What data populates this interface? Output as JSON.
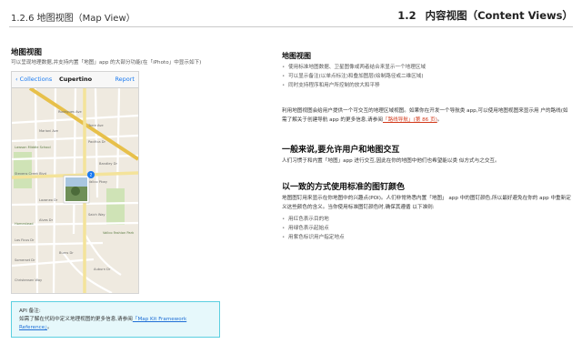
{
  "header": {
    "left": "1.2.6   地图视图（Map View）",
    "right_num": "1.2",
    "right_title": "内容视图（Content Views）"
  },
  "left": {
    "title": "地图视图",
    "subtitle": "可以呈现地理数据,并支持内置「地图」app 的大部分功能(在「iPhoto」中显示如下)"
  },
  "phone": {
    "back_label": "Collections",
    "title": "Cupertino",
    "action_label": "Report",
    "pin_count": "2",
    "streets": [
      "Stevens Creek Blvd",
      "Rodrigues Ave",
      "Torre Ave",
      "Pacifica Dr",
      "Mariani Ave",
      "Bandley Dr",
      "De Anza Blvd",
      "Vallco Pkwy",
      "Lazaneo Dr",
      "Alves Dr",
      "Saich Way",
      "Kentwood Ave",
      "Miller Ave",
      "Portal Ave",
      "Los Ficus Dr",
      "Somerset Dr",
      "Christensen Way",
      "Burns Dr",
      "Calle Ave",
      "Tantau Ave",
      "Auburn Dr",
      "Fremont Park"
    ],
    "places": [
      "Lawson Middle School",
      "Vallco Fashion Park",
      "Homestead"
    ]
  },
  "note": {
    "label": "API 备注:",
    "text": "如需了解在代码中定义地理视图的更多信息,请参阅",
    "link": "「Map Kit Framework Reference」",
    "tail": "。"
  },
  "right": {
    "s1": {
      "title": "地图视图",
      "bullets": [
        "使用标准地图数据、卫星图像或两者结合来显示一个地理区域",
        "可以显示备注(以单点标注)和叠加图层(绘制路径或二维区域)",
        "同时支持程序和用户所控制的放大和平移"
      ],
      "para": "利用地图视图会给用户提供一个可交互的地理区域视图。如果你在开发一个导航类 app,可以使用地图视图来显示用 户的路线(如需了解关于创建导航 app 的更多信息,请参阅",
      "para_link": "「路线导航」(第 86 页)",
      "para_tail": "。"
    },
    "s2": {
      "title": "一般来说,要允许用户和地图交互",
      "para": "人们习惯于和内置「地图」app 进行交互,因此在你的地图中他们也希望能以类 似方式与之交互。"
    },
    "s3": {
      "title": "以一致的方式使用标准的图钉颜色",
      "para": "地图图钉用来显示在你地图中的兴趣点(POI)。人们非常熟悉内置「地图」 app 中的图钉颜色,所以最好避免在你的 app 中重新定义这些颜色的含义。当你使用标准图钉颜色时,确保其遵循 以下准则:",
      "bullets": [
        "用红色表示目的地",
        "用绿色表示起始点",
        "用紫色标识用户指定地点"
      ]
    }
  },
  "colors": {
    "accent": "#1a7af0",
    "link": "#d23a1c",
    "note_bg": "#e6f8fb",
    "note_border": "#5bcfe0"
  }
}
